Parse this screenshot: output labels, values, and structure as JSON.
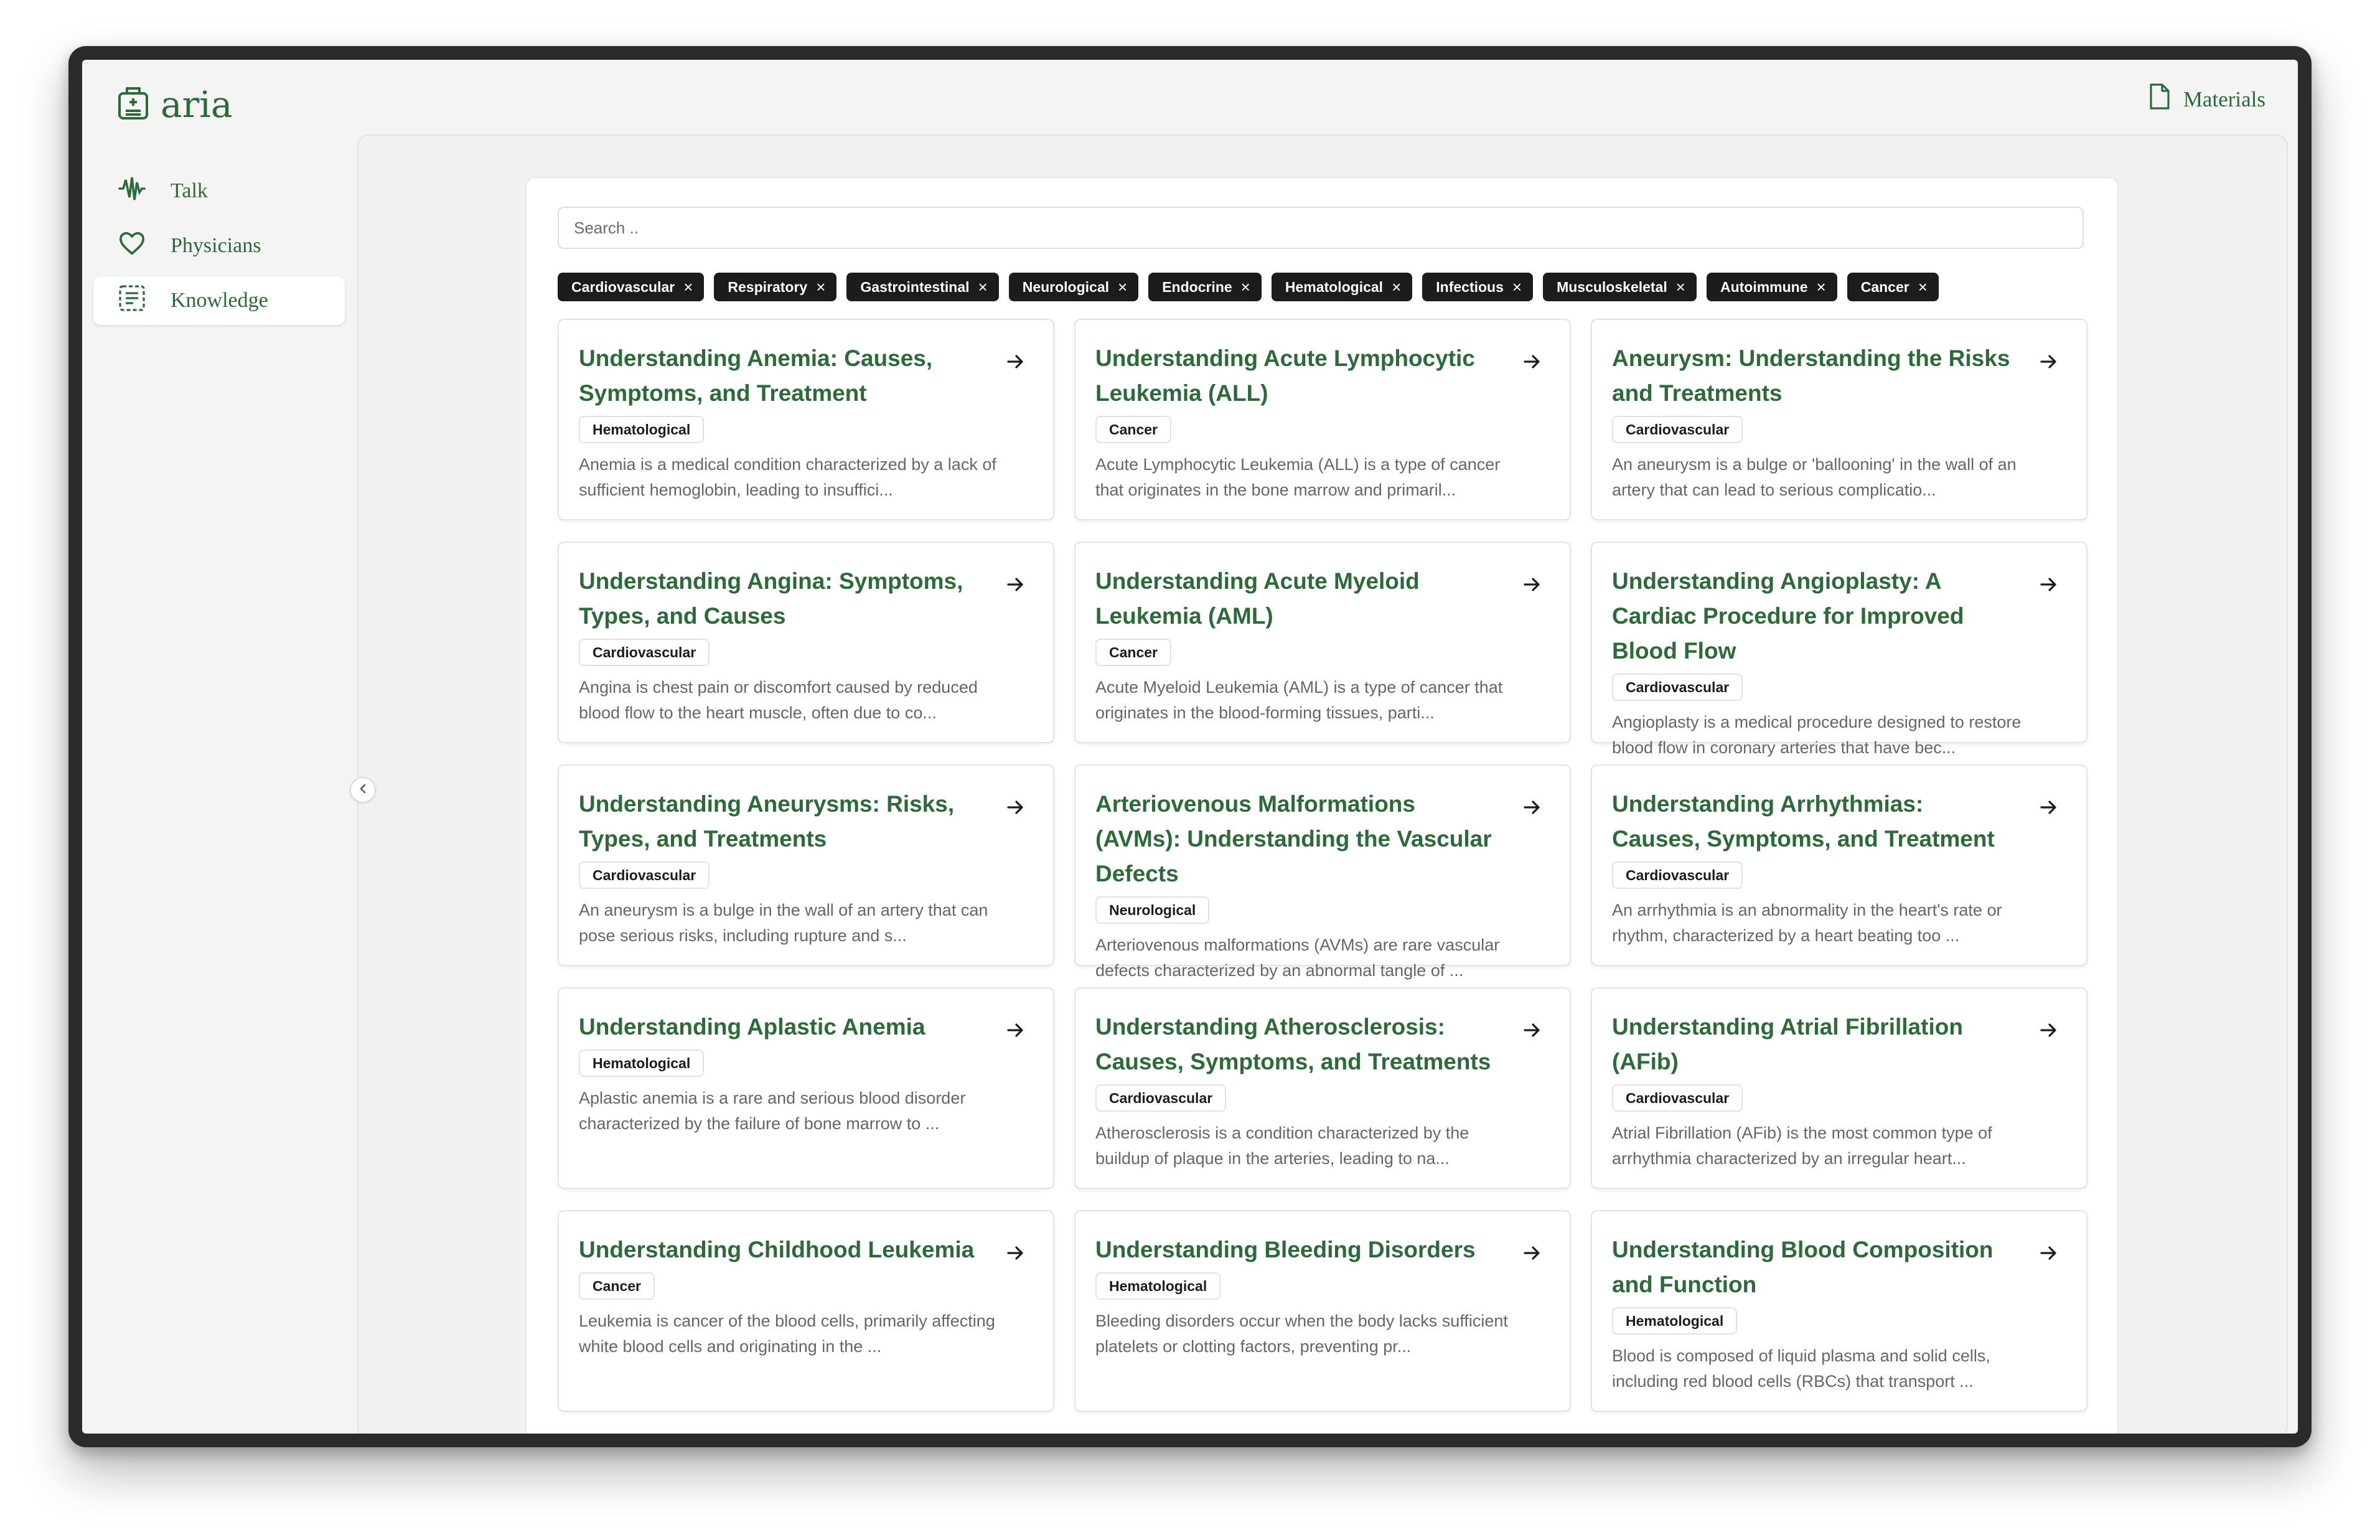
{
  "app": {
    "name": "aria"
  },
  "header": {
    "materials_label": "Materials"
  },
  "sidebar": {
    "items": [
      {
        "label": "Talk",
        "icon": "waveform-icon",
        "active": false
      },
      {
        "label": "Physicians",
        "icon": "heart-icon",
        "active": false
      },
      {
        "label": "Knowledge",
        "icon": "document-list-icon",
        "active": true
      }
    ]
  },
  "search": {
    "placeholder": "Search ..",
    "value": ""
  },
  "filters": [
    "Cardiovascular",
    "Respiratory",
    "Gastrointestinal",
    "Neurological",
    "Endocrine",
    "Hematological",
    "Infectious",
    "Musculoskeletal",
    "Autoimmune",
    "Cancer"
  ],
  "cards": [
    {
      "title": "Understanding Anemia: Causes, Symptoms, and Treatment",
      "tag": "Hematological",
      "description": "Anemia is a medical condition characterized by a lack of sufficient hemoglobin, leading to insuffici..."
    },
    {
      "title": "Understanding Acute Lymphocytic Leukemia (ALL)",
      "tag": "Cancer",
      "description": "Acute Lymphocytic Leukemia (ALL) is a type of cancer that originates in the bone marrow and primaril..."
    },
    {
      "title": "Aneurysm: Understanding the Risks and Treatments",
      "tag": "Cardiovascular",
      "description": "An aneurysm is a bulge or 'ballooning' in the wall of an artery that can lead to serious complicatio..."
    },
    {
      "title": "Understanding Angina: Symptoms, Types, and Causes",
      "tag": "Cardiovascular",
      "description": "Angina is chest pain or discomfort caused by reduced blood flow to the heart muscle, often due to co..."
    },
    {
      "title": "Understanding Acute Myeloid Leukemia (AML)",
      "tag": "Cancer",
      "description": "Acute Myeloid Leukemia (AML) is a type of cancer that originates in the blood-forming tissues, parti..."
    },
    {
      "title": "Understanding Angioplasty: A Cardiac Procedure for Improved Blood Flow",
      "tag": "Cardiovascular",
      "description": "Angioplasty is a medical procedure designed to restore blood flow in coronary arteries that have bec..."
    },
    {
      "title": "Understanding Aneurysms: Risks, Types, and Treatments",
      "tag": "Cardiovascular",
      "description": "An aneurysm is a bulge in the wall of an artery that can pose serious risks, including rupture and s..."
    },
    {
      "title": "Arteriovenous Malformations (AVMs): Understanding the Vascular Defects",
      "tag": "Neurological",
      "description": "Arteriovenous malformations (AVMs) are rare vascular defects characterized by an abnormal tangle of ..."
    },
    {
      "title": "Understanding Arrhythmias: Causes, Symptoms, and Treatment",
      "tag": "Cardiovascular",
      "description": "An arrhythmia is an abnormality in the heart's rate or rhythm, characterized by a heart beating too ..."
    },
    {
      "title": "Understanding Aplastic Anemia",
      "tag": "Hematological",
      "description": "Aplastic anemia is a rare and serious blood disorder characterized by the failure of bone marrow to ..."
    },
    {
      "title": "Understanding Atherosclerosis: Causes, Symptoms, and Treatments",
      "tag": "Cardiovascular",
      "description": "Atherosclerosis is a condition characterized by the buildup of plaque in the arteries, leading to na..."
    },
    {
      "title": "Understanding Atrial Fibrillation (AFib)",
      "tag": "Cardiovascular",
      "description": "Atrial Fibrillation (AFib) is the most common type of arrhythmia characterized by an irregular heart..."
    },
    {
      "title": "Understanding Childhood Leukemia",
      "tag": "Cancer",
      "description": "Leukemia is cancer of the blood cells, primarily affecting white blood cells and originating in the ..."
    },
    {
      "title": "Understanding Bleeding Disorders",
      "tag": "Hematological",
      "description": "Bleeding disorders occur when the body lacks sufficient platelets or clotting factors, preventing pr..."
    },
    {
      "title": "Understanding Blood Composition and Function",
      "tag": "Hematological",
      "description": "Blood is composed of liquid plasma and solid cells, including red blood cells (RBCs) that transport ..."
    }
  ],
  "colors": {
    "brand_green": "#2d6a3a",
    "chip_bg": "#1c1c1c"
  }
}
